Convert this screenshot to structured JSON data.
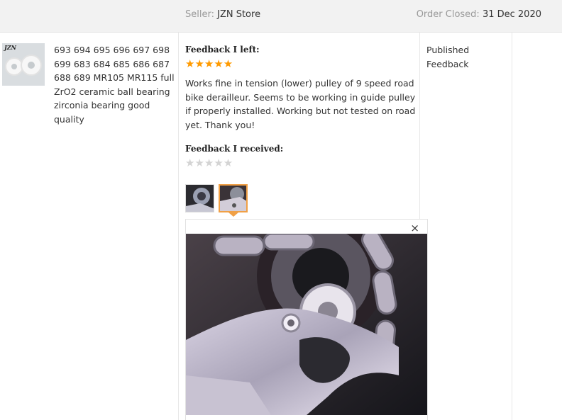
{
  "order": {
    "seller_label": "Seller:",
    "seller_name": "JZN Store",
    "closed_label": "Order Closed:",
    "closed_date": "31 Dec 2020"
  },
  "product": {
    "brand_mark": "JZN",
    "title": "693 694 695 696 697 698 699 683 684 685 686 687 688 689 MR105 MR115 full ZrO2 ceramic ball bearing zirconia bearing good quality"
  },
  "feedback": {
    "left_heading": "Feedback I left:",
    "left_rating": 5,
    "left_stars": "★★★★★",
    "left_text": "Works fine in tension (lower) pulley of 9 speed road bike derailleur. Seems to be working in guide pulley if properly installed. Working but not tested on road yet. Thank you!",
    "received_heading": "Feedback I received:",
    "received_rating": 0,
    "received_stars": "★★★★★"
  },
  "status": {
    "text": "Published Feedback"
  },
  "photos": {
    "count": 2,
    "selected_index": 1,
    "close_symbol": "×"
  },
  "colors": {
    "star_on": "#ff9a00",
    "star_off": "#d4d4d4",
    "selected_border": "#f0a046",
    "header_bg": "#f2f2f2"
  }
}
